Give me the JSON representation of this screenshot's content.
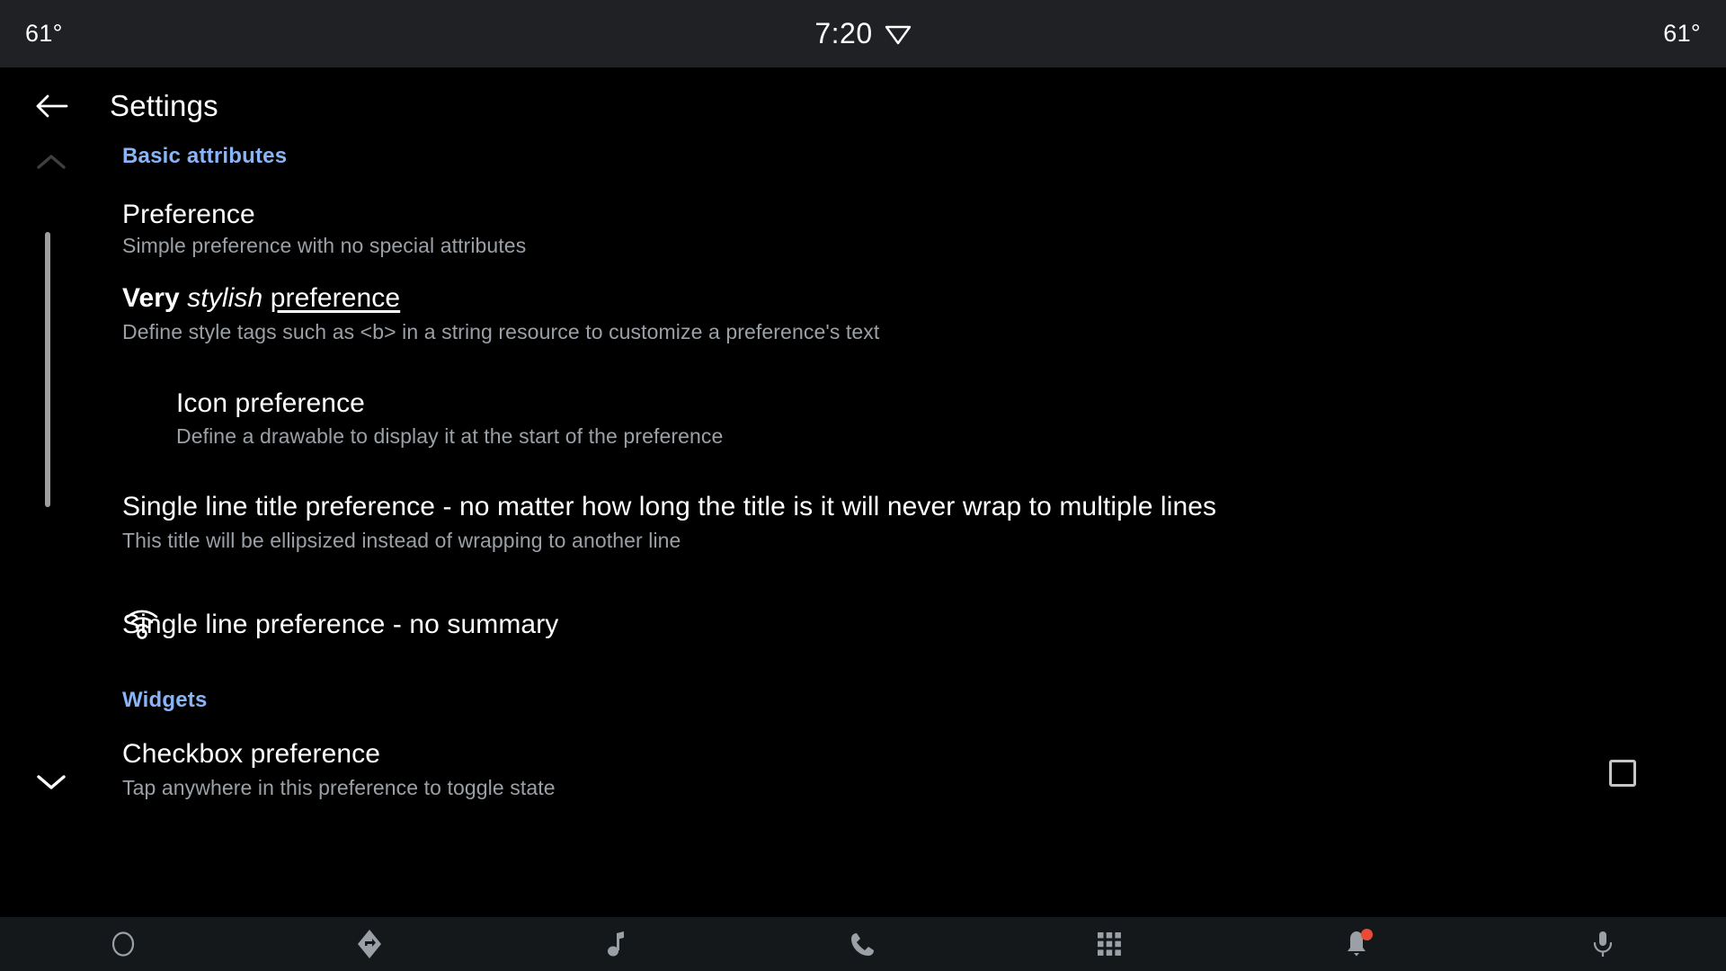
{
  "status_bar": {
    "left_temp": "61°",
    "clock": "7:20",
    "right_temp": "61°",
    "wifi_icon": "wifi-icon"
  },
  "toolbar": {
    "back_icon": "arrow-back-icon",
    "title": "Settings"
  },
  "colors": {
    "category_accent": "#8ab4f8",
    "title_text": "#ffffff",
    "summary_text": "#9aa0a6",
    "background": "#000000",
    "status_bar_bg": "#202124",
    "nav_bar_bg": "#14181b",
    "badge": "#ea4b35",
    "scrollbar": "#9e9e9e"
  },
  "sections": [
    {
      "key": "basic_attributes",
      "header": "Basic attributes",
      "chevron": "chevron-up-icon",
      "expanded": true
    },
    {
      "key": "widgets",
      "header": "Widgets",
      "chevron": "chevron-down-icon",
      "expanded": true
    }
  ],
  "preferences": {
    "simple": {
      "title": "Preference",
      "summary": "Simple preference with no special attributes"
    },
    "stylish": {
      "title_part_bold": "Very",
      "title_part_italic": "stylish",
      "title_part_underline": "preference",
      "summary": "Define style tags such as <b> in a string resource to customize a preference's text"
    },
    "icon": {
      "icon": "wifi-icon",
      "title": "Icon preference",
      "summary": "Define a drawable to display it at the start of the preference"
    },
    "single_line_title": {
      "title": "Single line title preference - no matter how long the title is it will never wrap to multiple lines",
      "summary": "This title will be ellipsized instead of wrapping to another line"
    },
    "single_line_no_summary": {
      "title": "Single line preference - no summary"
    },
    "checkbox": {
      "title": "Checkbox preference",
      "summary": "Tap anywhere in this preference to toggle state",
      "checked": false
    }
  },
  "bottom_nav": {
    "items": [
      {
        "key": "home",
        "icon": "home-circle-icon"
      },
      {
        "key": "navigation",
        "icon": "navigation-arrow-icon"
      },
      {
        "key": "music",
        "icon": "music-note-icon"
      },
      {
        "key": "phone",
        "icon": "phone-icon"
      },
      {
        "key": "apps",
        "icon": "apps-grid-icon"
      },
      {
        "key": "notifications",
        "icon": "bell-icon",
        "badge": true
      },
      {
        "key": "assistant",
        "icon": "microphone-icon"
      }
    ]
  }
}
